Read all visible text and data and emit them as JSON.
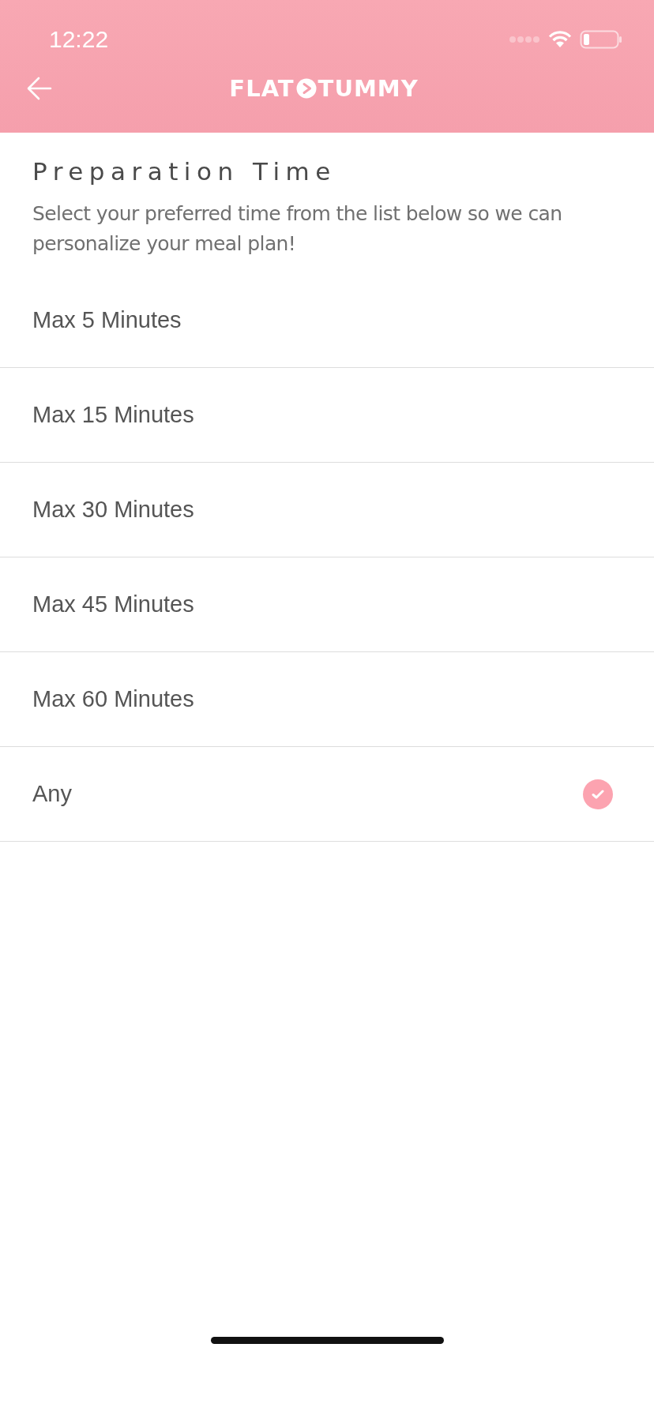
{
  "status_bar": {
    "time": "12:22"
  },
  "header": {
    "logo_left": "FLAT",
    "logo_right": "TUMMY"
  },
  "title": "Preparation Time",
  "description": "Select your preferred time from the list below so we can personalize your meal plan!",
  "options": [
    {
      "label": "Max 5 Minutes",
      "selected": false
    },
    {
      "label": "Max 15 Minutes",
      "selected": false
    },
    {
      "label": "Max 30 Minutes",
      "selected": false
    },
    {
      "label": "Max 45 Minutes",
      "selected": false
    },
    {
      "label": "Max 60 Minutes",
      "selected": false
    },
    {
      "label": "Any",
      "selected": true
    }
  ]
}
